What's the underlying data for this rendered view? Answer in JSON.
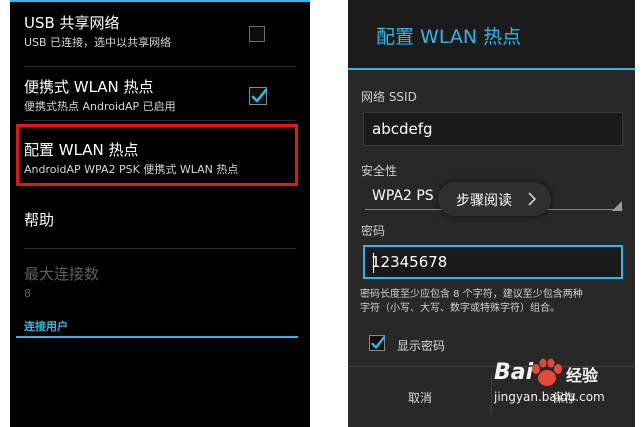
{
  "left": {
    "items": [
      {
        "title": "USB 共享网络",
        "summary": "USB 已连接，选中以共享网络",
        "checked": false
      },
      {
        "title": "便携式 WLAN 热点",
        "summary": "便携式热点 AndroidAP 已启用",
        "checked": true
      },
      {
        "title": "配置 WLAN 热点",
        "summary": "AndroidAP WPA2 PSK 便携式 WLAN 热点"
      },
      {
        "title": "帮助"
      },
      {
        "title": "最大连接数",
        "summary": "8"
      }
    ],
    "section_header": "连接用户"
  },
  "dialog": {
    "title": "配置 WLAN 热点",
    "ssid_label": "网络 SSID",
    "ssid_value": "abcdefg",
    "security_label": "安全性",
    "security_value": "WPA2 PS",
    "password_label": "密码",
    "password_value": "12345678",
    "hint_line1": "密码长度至少应包含 8 个字符，建议至少包含两种",
    "hint_line2": "字符（小写、大写、数字或特殊字符）组合。",
    "show_password_label": "显示密码",
    "show_password_checked": true,
    "cancel_label": "取消",
    "save_label": "保存"
  },
  "tooltip": {
    "label": "步骤阅读"
  },
  "watermark": {
    "brand": "Bai",
    "brand_suffix": "经验",
    "url": "jingyan.baidu.com"
  },
  "colors": {
    "accent": "#33b5e5",
    "highlight": "#e0161c",
    "left_background": "#000000",
    "dialog_background": "#282828"
  },
  "icons": [
    "checkbox-empty",
    "checkbox-checked-icon",
    "spinner-arrow-icon",
    "chevron-right-icon",
    "baidu-paw-icon"
  ]
}
